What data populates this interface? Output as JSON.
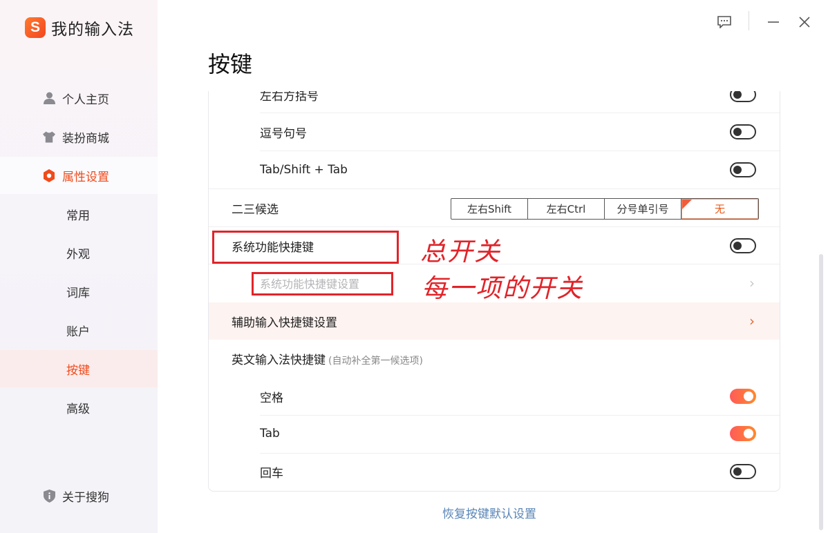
{
  "app": {
    "logo_letter": "S",
    "title": "我的输入法"
  },
  "sidebar": {
    "items": [
      {
        "label": "个人主页",
        "icon": "user-icon"
      },
      {
        "label": "装扮商城",
        "icon": "shirt-icon"
      },
      {
        "label": "属性设置",
        "icon": "settings-hex-icon"
      }
    ],
    "sub_items": [
      "常用",
      "外观",
      "词库",
      "账户",
      "按键",
      "高级"
    ],
    "about": {
      "label": "关于搜狗",
      "icon": "shield-info-icon"
    }
  },
  "page": {
    "title": "按键"
  },
  "rows": {
    "brackets": "左右方括号",
    "comma_period": "逗号句号",
    "tab": "Tab/Shift + Tab",
    "second_third": "二三候选",
    "system_shortcut": "系统功能快捷键",
    "system_shortcut_settings": "系统功能快捷键设置",
    "assist_input": "辅助输入快捷键设置",
    "english_input": "英文输入法快捷键",
    "english_input_note": "(自动补全第一候选项)",
    "space": "空格",
    "tab_key": "Tab",
    "enter": "回车"
  },
  "segment": {
    "options": [
      "左右Shift",
      "左右Ctrl",
      "分号单引号",
      "无"
    ],
    "selected": "无"
  },
  "toggles": {
    "brackets": false,
    "comma_period": false,
    "tab": false,
    "system_shortcut": false,
    "space": true,
    "tab_key": true,
    "enter": false
  },
  "annotations": {
    "master": "总开关",
    "each": "每一项的开关"
  },
  "footer": {
    "restore": "恢复按键默认设置"
  },
  "colors": {
    "accent": "#f04b1c",
    "annotation": "#e0242a",
    "link": "#5a86b8"
  }
}
